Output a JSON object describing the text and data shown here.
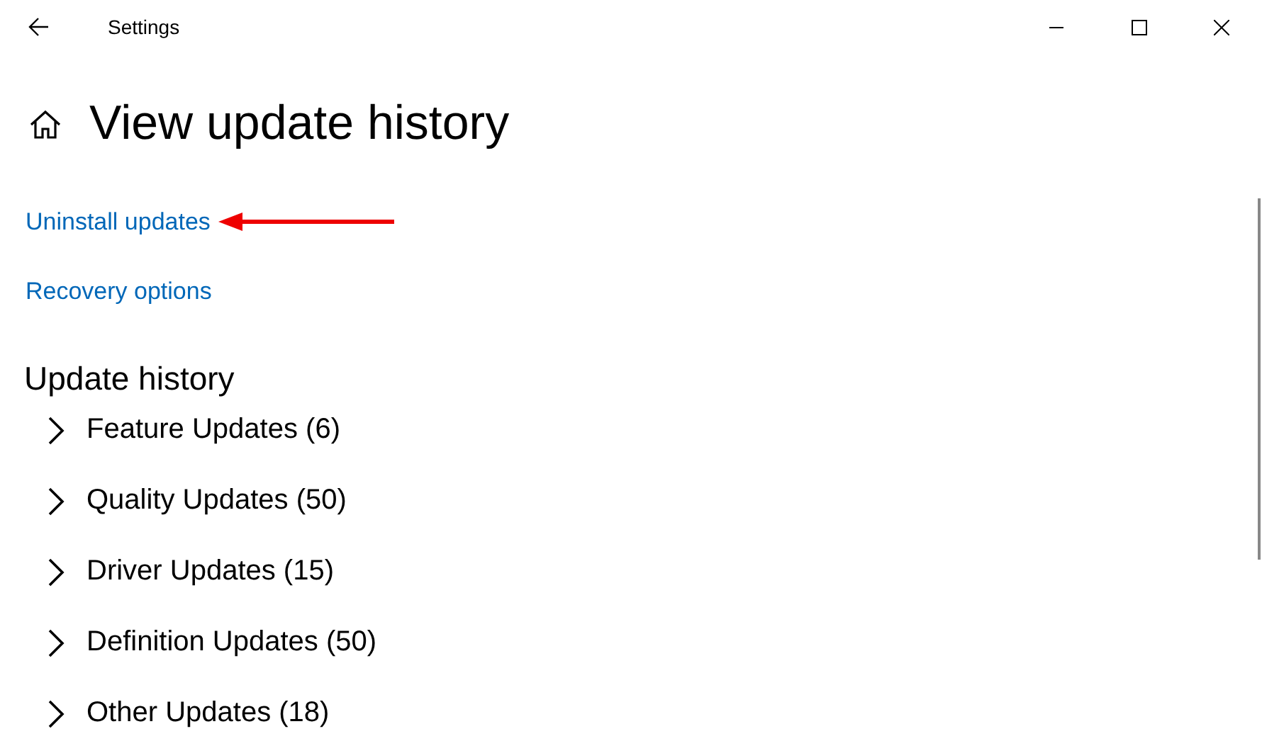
{
  "window": {
    "title": "Settings"
  },
  "page": {
    "title": "View update history"
  },
  "links": [
    {
      "label": "Uninstall updates",
      "annotated": true
    },
    {
      "label": "Recovery options",
      "annotated": false
    }
  ],
  "section": {
    "title": "Update history"
  },
  "categories": [
    {
      "label": "Feature Updates (6)",
      "expanded": false
    },
    {
      "label": "Quality Updates (50)",
      "expanded": false
    },
    {
      "label": "Driver Updates (15)",
      "expanded": false
    },
    {
      "label": "Definition Updates (50)",
      "expanded": false
    },
    {
      "label": "Other Updates (18)",
      "expanded": false
    }
  ]
}
